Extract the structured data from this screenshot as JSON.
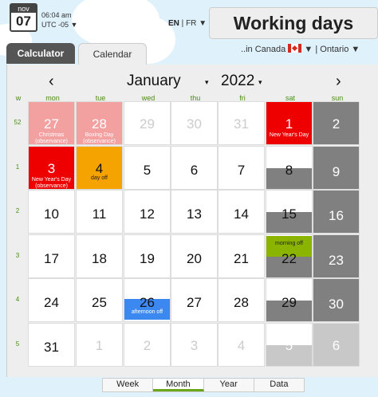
{
  "header": {
    "date_badge": {
      "month": "nov",
      "day": "07"
    },
    "time": "06:04 am",
    "timezone": "UTC -05 ▼",
    "languages": {
      "active": "EN",
      "other": "FR",
      "caret": "▼"
    },
    "app_title": "Working days",
    "country": "..in Canada",
    "country_caret": "▼",
    "region": "| Ontario ▼"
  },
  "tabs": [
    {
      "label": "Calculator",
      "active": false
    },
    {
      "label": "Calendar",
      "active": true
    }
  ],
  "calendar": {
    "prev_arrow": "‹",
    "next_arrow": "›",
    "month": "January",
    "month_caret": "▾",
    "year": "2022",
    "year_caret": "▾",
    "weekday_headers": [
      "w",
      "mon",
      "tue",
      "wed",
      "thu",
      "fri",
      "sat",
      "sun"
    ],
    "weeks": [
      {
        "week": "52",
        "days": [
          {
            "num": "27",
            "style": "pink",
            "label": "Christmas (observance)"
          },
          {
            "num": "28",
            "style": "pink",
            "label": "Boxing Day (observance)"
          },
          {
            "num": "29",
            "style": "muted"
          },
          {
            "num": "30",
            "style": "muted"
          },
          {
            "num": "31",
            "style": "muted"
          },
          {
            "num": "1",
            "style": "red",
            "label": "New Year's Day"
          },
          {
            "num": "2",
            "style": "sunday"
          }
        ]
      },
      {
        "week": "1",
        "days": [
          {
            "num": "3",
            "style": "red",
            "label": "New Year's Day (observance)"
          },
          {
            "num": "4",
            "style": "orange",
            "label": "day off"
          },
          {
            "num": "5",
            "style": "normal"
          },
          {
            "num": "6",
            "style": "normal"
          },
          {
            "num": "7",
            "style": "normal"
          },
          {
            "num": "8",
            "style": "saturday"
          },
          {
            "num": "9",
            "style": "sunday"
          }
        ]
      },
      {
        "week": "2",
        "days": [
          {
            "num": "10",
            "style": "normal"
          },
          {
            "num": "11",
            "style": "normal"
          },
          {
            "num": "12",
            "style": "normal"
          },
          {
            "num": "13",
            "style": "normal"
          },
          {
            "num": "14",
            "style": "normal"
          },
          {
            "num": "15",
            "style": "saturday"
          },
          {
            "num": "16",
            "style": "sunday"
          }
        ]
      },
      {
        "week": "3",
        "days": [
          {
            "num": "17",
            "style": "normal"
          },
          {
            "num": "18",
            "style": "normal"
          },
          {
            "num": "19",
            "style": "normal"
          },
          {
            "num": "20",
            "style": "normal"
          },
          {
            "num": "21",
            "style": "normal"
          },
          {
            "num": "22",
            "style": "saturday-morning",
            "label": "morning off"
          },
          {
            "num": "23",
            "style": "sunday"
          }
        ]
      },
      {
        "week": "4",
        "days": [
          {
            "num": "24",
            "style": "normal"
          },
          {
            "num": "25",
            "style": "normal"
          },
          {
            "num": "26",
            "style": "afternoon",
            "label": "afternoon off"
          },
          {
            "num": "27",
            "style": "normal"
          },
          {
            "num": "28",
            "style": "normal"
          },
          {
            "num": "29",
            "style": "saturday"
          },
          {
            "num": "30",
            "style": "sunday"
          }
        ]
      },
      {
        "week": "5",
        "days": [
          {
            "num": "31",
            "style": "normal"
          },
          {
            "num": "1",
            "style": "muted"
          },
          {
            "num": "2",
            "style": "muted"
          },
          {
            "num": "3",
            "style": "muted"
          },
          {
            "num": "4",
            "style": "muted"
          },
          {
            "num": "5",
            "style": "saturday-muted"
          },
          {
            "num": "6",
            "style": "sunday-muted"
          }
        ]
      }
    ]
  },
  "view_tabs": [
    {
      "label": "Week",
      "active": false
    },
    {
      "label": "Month",
      "active": true
    },
    {
      "label": "Year",
      "active": false
    },
    {
      "label": "Data",
      "active": false
    }
  ],
  "colors": {
    "holiday": "#ee0000",
    "observance": "#f3a0a0",
    "day_off": "#f5a300",
    "weekend": "#808080",
    "morning_off": "#8ab400",
    "afternoon_off": "#3a88f0",
    "accent_green": "#4a8d12"
  }
}
